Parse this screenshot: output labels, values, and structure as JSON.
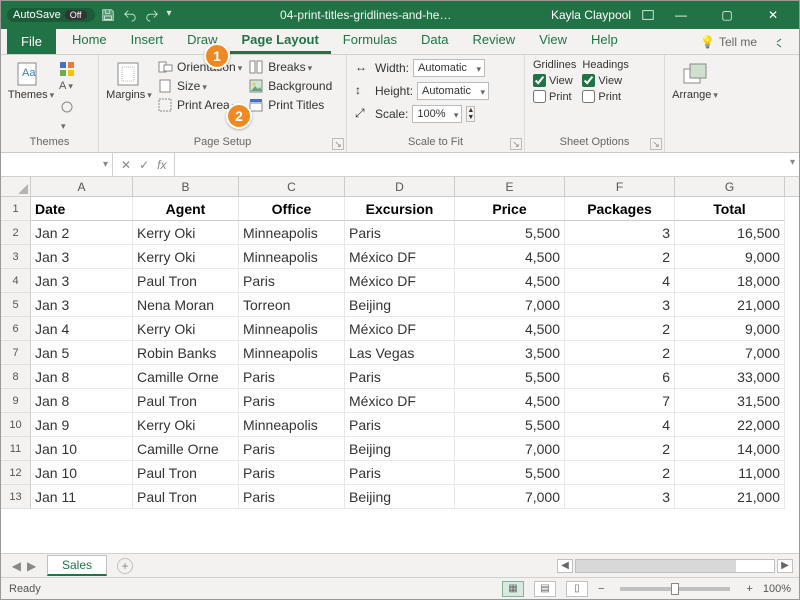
{
  "titlebar": {
    "autosave_label": "AutoSave",
    "autosave_state": "Off",
    "doc_title": "04-print-titles-gridlines-and-he…",
    "user": "Kayla Claypool"
  },
  "tabs": {
    "file": "File",
    "items": [
      "Home",
      "Insert",
      "Draw",
      "Page Layout",
      "Formulas",
      "Data",
      "Review",
      "View",
      "Help"
    ],
    "active_index": 3,
    "tell_me": "Tell me"
  },
  "ribbon": {
    "themes": {
      "label": "Themes",
      "btn": "Themes"
    },
    "page_setup": {
      "label": "Page Setup",
      "margins": "Margins",
      "orientation": "Orientation",
      "size": "Size",
      "print_area": "Print Area",
      "breaks": "Breaks",
      "background": "Background",
      "print_titles": "Print Titles"
    },
    "scale": {
      "label": "Scale to Fit",
      "width_lbl": "Width:",
      "width_val": "Automatic",
      "height_lbl": "Height:",
      "height_val": "Automatic",
      "scale_lbl": "Scale:",
      "scale_val": "100%"
    },
    "sheet_options": {
      "label": "Sheet Options",
      "gridlines": "Gridlines",
      "headings": "Headings",
      "view": "View",
      "print": "Print",
      "grid_view": true,
      "grid_print": false,
      "head_view": true,
      "head_print": false
    },
    "arrange": {
      "label": "Arrange"
    }
  },
  "formula_bar": {
    "namebox": "",
    "fx": "fx"
  },
  "columns": [
    "A",
    "B",
    "C",
    "D",
    "E",
    "F",
    "G"
  ],
  "headers": [
    "Date",
    "Agent",
    "Office",
    "Excursion",
    "Price",
    "Packages",
    "Total"
  ],
  "rows": [
    {
      "n": 2,
      "c": [
        "Jan 2",
        "Kerry Oki",
        "Minneapolis",
        "Paris",
        "5,500",
        "3",
        "16,500"
      ]
    },
    {
      "n": 3,
      "c": [
        "Jan 3",
        "Kerry Oki",
        "Minneapolis",
        "México DF",
        "4,500",
        "2",
        "9,000"
      ]
    },
    {
      "n": 4,
      "c": [
        "Jan 3",
        "Paul Tron",
        "Paris",
        "México DF",
        "4,500",
        "4",
        "18,000"
      ]
    },
    {
      "n": 5,
      "c": [
        "Jan 3",
        "Nena Moran",
        "Torreon",
        "Beijing",
        "7,000",
        "3",
        "21,000"
      ]
    },
    {
      "n": 6,
      "c": [
        "Jan 4",
        "Kerry Oki",
        "Minneapolis",
        "México DF",
        "4,500",
        "2",
        "9,000"
      ]
    },
    {
      "n": 7,
      "c": [
        "Jan 5",
        "Robin Banks",
        "Minneapolis",
        "Las Vegas",
        "3,500",
        "2",
        "7,000"
      ]
    },
    {
      "n": 8,
      "c": [
        "Jan 8",
        "Camille Orne",
        "Paris",
        "Paris",
        "5,500",
        "6",
        "33,000"
      ]
    },
    {
      "n": 9,
      "c": [
        "Jan 8",
        "Paul Tron",
        "Paris",
        "México DF",
        "4,500",
        "7",
        "31,500"
      ]
    },
    {
      "n": 10,
      "c": [
        "Jan 9",
        "Kerry Oki",
        "Minneapolis",
        "Paris",
        "5,500",
        "4",
        "22,000"
      ]
    },
    {
      "n": 11,
      "c": [
        "Jan 10",
        "Camille Orne",
        "Paris",
        "Beijing",
        "7,000",
        "2",
        "14,000"
      ]
    },
    {
      "n": 12,
      "c": [
        "Jan 10",
        "Paul Tron",
        "Paris",
        "Paris",
        "5,500",
        "2",
        "11,000"
      ]
    },
    {
      "n": 13,
      "c": [
        "Jan 11",
        "Paul Tron",
        "Paris",
        "Beijing",
        "7,000",
        "3",
        "21,000"
      ]
    }
  ],
  "sheet": {
    "tab": "Sales"
  },
  "status": {
    "ready": "Ready",
    "zoom": "100%"
  },
  "callouts": {
    "one": "1",
    "two": "2"
  }
}
